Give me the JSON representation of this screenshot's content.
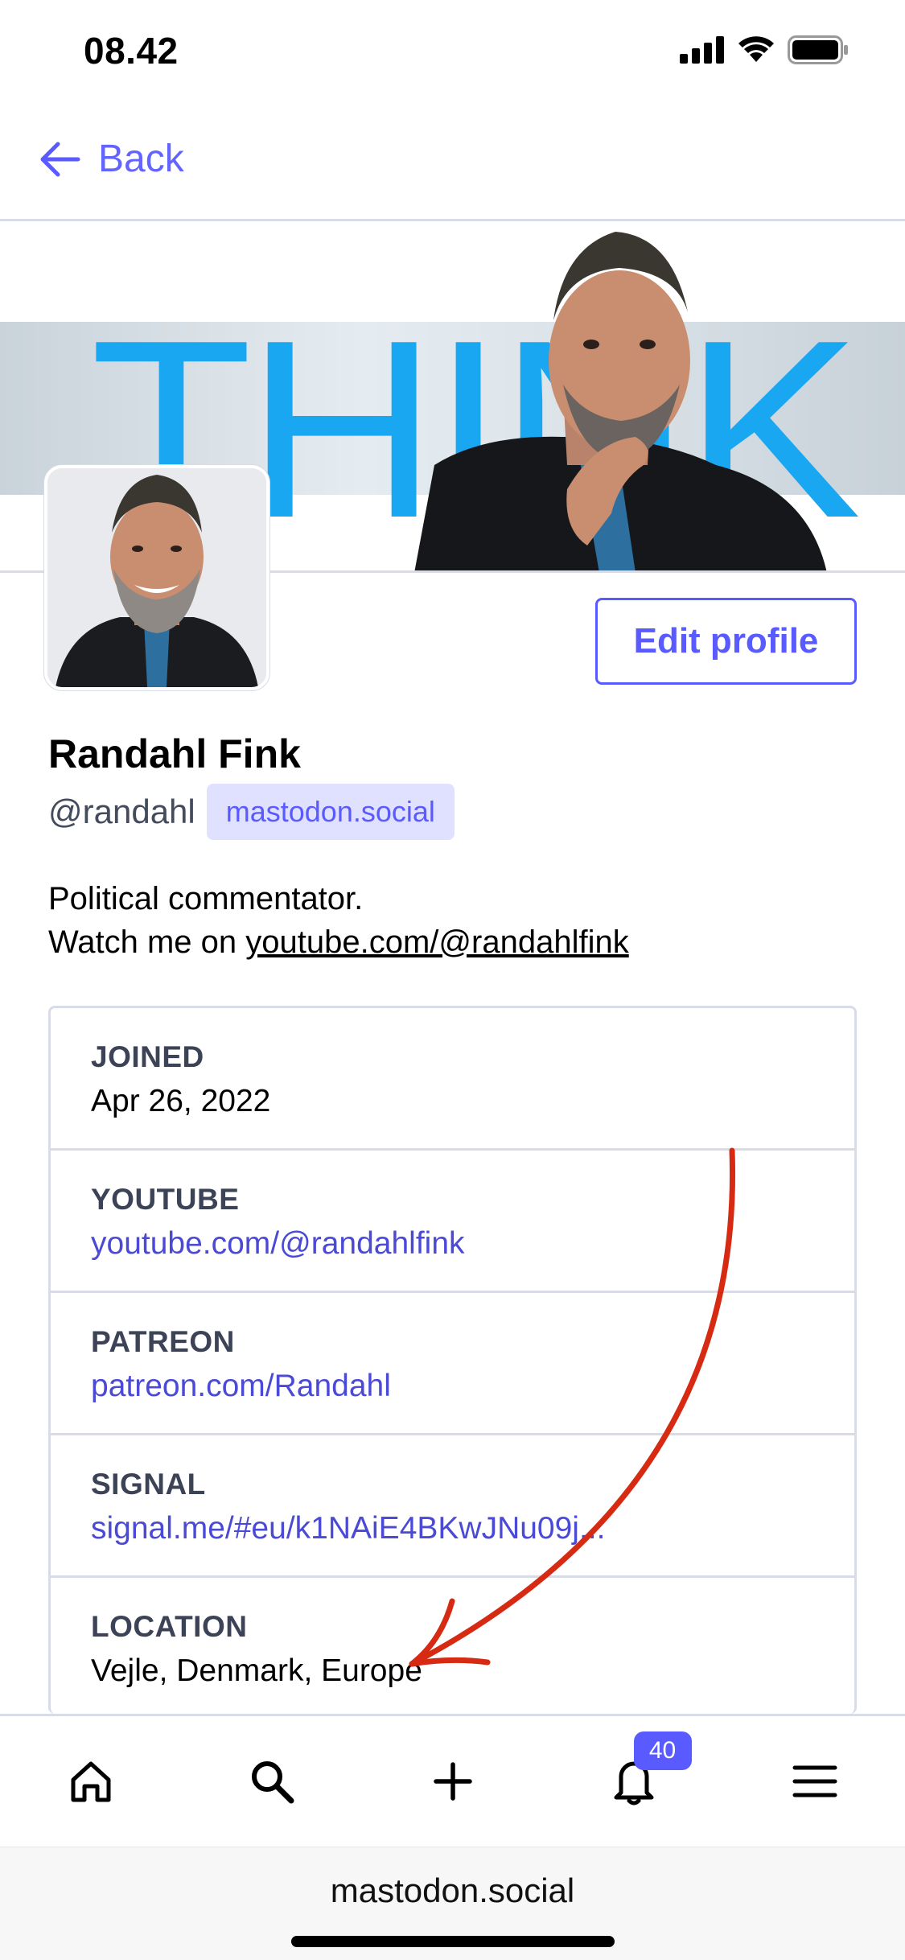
{
  "status_bar": {
    "time": "08.42"
  },
  "nav": {
    "back_label": "Back"
  },
  "header": {
    "banner_word": "THINK"
  },
  "profile": {
    "display_name": "Randahl Fink",
    "handle": "@randahl",
    "domain": "mastodon.social",
    "edit_button": "Edit profile",
    "bio_line1": "Political commentator.",
    "bio_line2_prefix": "Watch me on ",
    "bio_link": "youtube.com/@randahlfink"
  },
  "fields": [
    {
      "label": "JOINED",
      "value": "Apr 26, 2022"
    },
    {
      "label": "YOUTUBE",
      "value": "youtube.com/@randahlfink"
    },
    {
      "label": "PATREON",
      "value": "patreon.com/Randahl"
    },
    {
      "label": "SIGNAL",
      "value": "signal.me/#eu/k1NAiE4BKwJNu09j..."
    },
    {
      "label": "LOCATION",
      "value": "Vejle, Denmark, Europe"
    }
  ],
  "tabbar": {
    "items": [
      "home-icon",
      "search-icon",
      "compose-icon",
      "notifications-icon",
      "menu-icon"
    ],
    "notification_count": "40"
  },
  "browser": {
    "url": "mastodon.social"
  },
  "colors": {
    "accent": "#595aff",
    "annotation": "#d62a12"
  }
}
